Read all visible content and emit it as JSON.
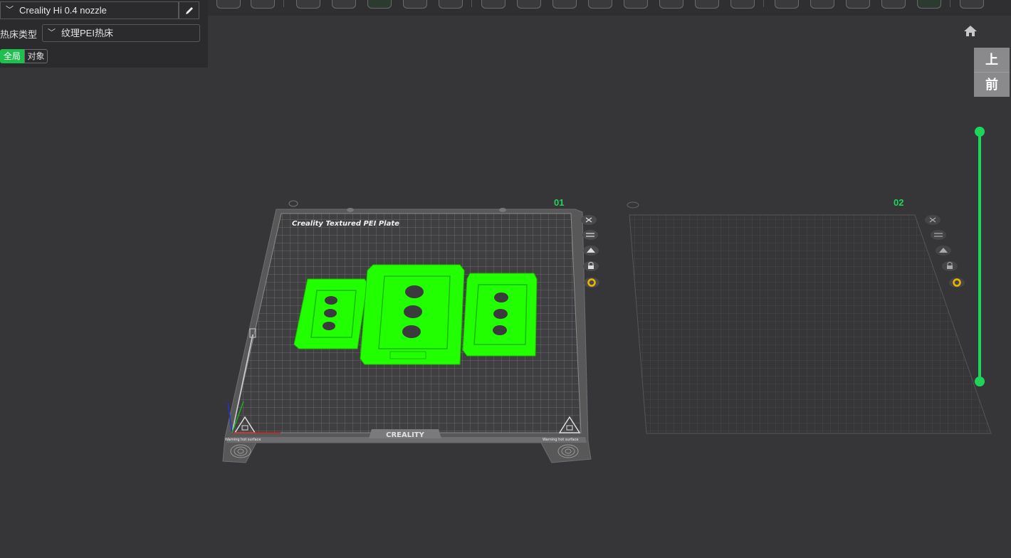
{
  "left_panel": {
    "printer": "Creality Hi 0.4 nozzle",
    "bed_label": "热床类型",
    "bed_type": "纹理PEI热床",
    "tabs": [
      "全局",
      "对象"
    ]
  },
  "view_cube": {
    "top_label": "上",
    "front_label": "前"
  },
  "plates": [
    {
      "number": "01",
      "plate_title": "Creality Textured PEI Plate",
      "brand": "CREALITY",
      "warning_left": "Warning hot surface",
      "warning_right": "Warning hot surface"
    },
    {
      "number": "02"
    }
  ],
  "plate_tools": [
    "close-icon",
    "arrange-icon",
    "orient-icon",
    "lock-icon",
    "settings-gear-icon"
  ],
  "colors": {
    "accent": "#1fd45a",
    "model": "#22ff00",
    "background": "#363638",
    "panel": "#2b2b2d",
    "gear": "#e8b800"
  }
}
